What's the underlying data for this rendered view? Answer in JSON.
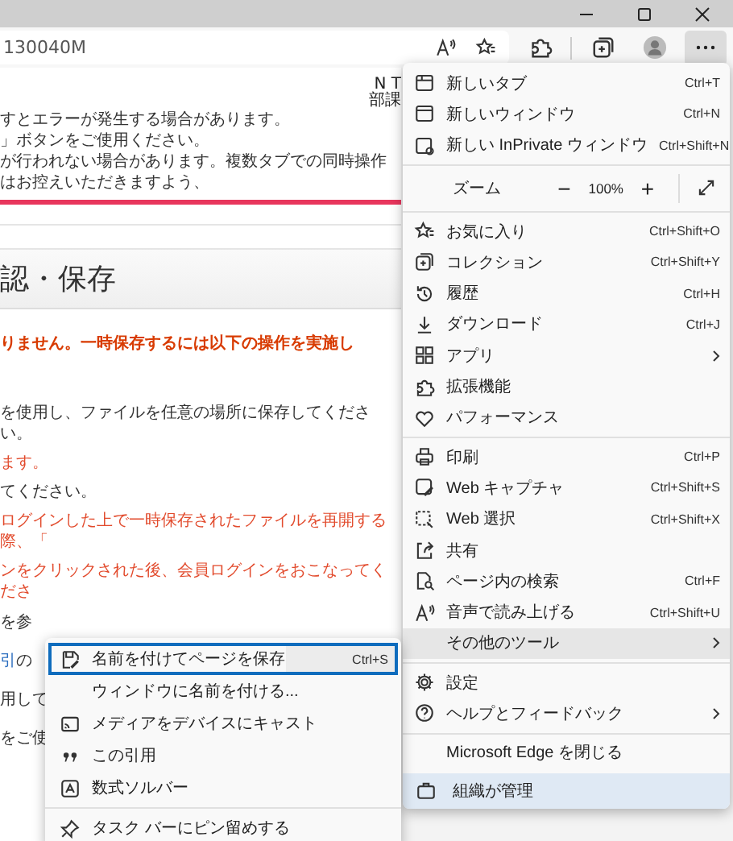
{
  "address_bar": {
    "value": "130040M"
  },
  "more_button": {
    "selected": true
  },
  "page": {
    "header_right": [
      "N T",
      "部課"
    ],
    "notices": [
      "すとエラーが発生する場合があります。",
      "」ボタンをご使用ください。",
      "が行われない場合があります。複数タブでの同時操作はお控えいただきますよう、"
    ],
    "heading": "認・保存",
    "warning": "りません。一時保存するには以下の操作を実施し",
    "lines": [
      {
        "text": "を使用し、ファイルを任意の場所に保存してください。",
        "kind": "plain"
      },
      {
        "text": "ます。",
        "kind": "alert"
      },
      {
        "text": "てください。",
        "kind": "plain"
      },
      {
        "text": "ログインした上で一時保存されたファイルを再開する際、「",
        "kind": "alert"
      },
      {
        "text": "ンをクリックされた後、会員ログインをおこなってくださ",
        "kind": "alert"
      }
    ],
    "fragments": [
      {
        "parts": [
          {
            "text": "を参",
            "kind": "plain"
          }
        ]
      },
      {
        "parts": [
          {
            "text": "引",
            "kind": "link"
          },
          {
            "text": "の",
            "kind": "plain"
          }
        ]
      },
      {
        "parts": [
          {
            "text": "用して",
            "kind": "plain"
          }
        ]
      },
      {
        "parts": [
          {
            "text": "をご使",
            "kind": "plain"
          }
        ]
      }
    ]
  },
  "main_menu": {
    "sections": [
      {
        "kind": "items",
        "items": [
          {
            "label": "新しいタブ",
            "shortcut": "Ctrl+T",
            "submenu": false,
            "selected": false
          },
          {
            "label": "新しいウィンドウ",
            "shortcut": "Ctrl+N",
            "submenu": false,
            "selected": false
          },
          {
            "label": "新しい InPrivate ウィンドウ",
            "shortcut": "Ctrl+Shift+N",
            "submenu": false,
            "selected": false
          }
        ]
      },
      {
        "kind": "zoom",
        "label": "ズーム",
        "minus": "−",
        "value": "100%",
        "plus": "+"
      },
      {
        "kind": "items",
        "items": [
          {
            "label": "お気に入り",
            "shortcut": "Ctrl+Shift+O",
            "submenu": false,
            "selected": false
          },
          {
            "label": "コレクション",
            "shortcut": "Ctrl+Shift+Y",
            "submenu": false,
            "selected": false
          },
          {
            "label": "履歴",
            "shortcut": "Ctrl+H",
            "submenu": false,
            "selected": false
          },
          {
            "label": "ダウンロード",
            "shortcut": "Ctrl+J",
            "submenu": false,
            "selected": false
          },
          {
            "label": "アプリ",
            "submenu": true,
            "selected": false
          },
          {
            "label": "拡張機能",
            "submenu": false,
            "selected": false
          },
          {
            "label": "パフォーマンス",
            "submenu": false,
            "selected": false
          }
        ]
      },
      {
        "kind": "items",
        "items": [
          {
            "label": "印刷",
            "shortcut": "Ctrl+P",
            "submenu": false,
            "selected": false
          },
          {
            "label": "Web キャプチャ",
            "shortcut": "Ctrl+Shift+S",
            "submenu": false,
            "selected": false
          },
          {
            "label": "Web 選択",
            "shortcut": "Ctrl+Shift+X",
            "submenu": false,
            "selected": false
          },
          {
            "label": "共有",
            "submenu": false,
            "selected": false
          },
          {
            "label": "ページ内の検索",
            "shortcut": "Ctrl+F",
            "submenu": false,
            "selected": false
          },
          {
            "label": "音声で読み上げる",
            "shortcut": "Ctrl+Shift+U",
            "submenu": false,
            "selected": false
          },
          {
            "label": "その他のツール",
            "submenu": true,
            "selected": true
          }
        ]
      },
      {
        "kind": "items",
        "items": [
          {
            "label": "設定",
            "submenu": false,
            "selected": false
          },
          {
            "label": "ヘルプとフィードバック",
            "submenu": true,
            "selected": false
          }
        ]
      },
      {
        "kind": "items",
        "items": [
          {
            "label": "Microsoft Edge を閉じる",
            "submenu": false,
            "selected": false
          }
        ]
      }
    ],
    "footer": {
      "label": "組織が管理"
    }
  },
  "sub_menu": {
    "sections": [
      [
        {
          "label": "名前を付けてページを保存",
          "shortcut": "Ctrl+S",
          "selected": true
        },
        {
          "label": "ウィンドウに名前を付ける...",
          "selected": false
        },
        {
          "label": "メディアをデバイスにキャスト",
          "selected": false
        },
        {
          "label": "この引用",
          "selected": false
        },
        {
          "label": "数式ソルバー",
          "selected": false
        }
      ],
      [
        {
          "label": "タスク バーにピン留めする",
          "selected": false
        }
      ]
    ]
  }
}
